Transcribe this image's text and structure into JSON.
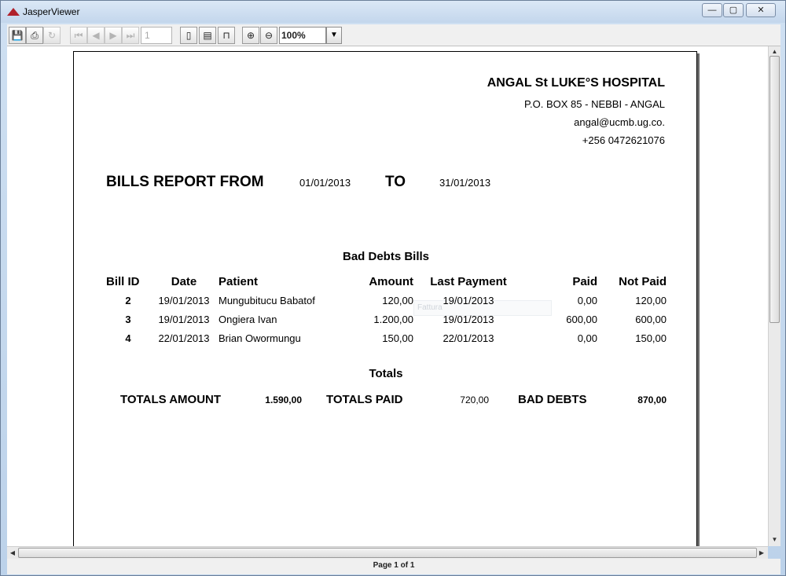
{
  "window": {
    "title": "JasperViewer",
    "min": "—",
    "max": "▢",
    "close": "✕"
  },
  "toolbar": {
    "save_icon": "💾",
    "print_icon": "⎙",
    "reload_icon": "↻",
    "first_icon": "⏮",
    "prev_icon": "◀",
    "next_icon": "▶",
    "last_icon": "⏭",
    "page_value": "1",
    "actual_size_icon": "▯",
    "fit_page_icon": "▤",
    "fit_width_icon": "⊓",
    "zoom_in_icon": "⊕",
    "zoom_out_icon": "⊖",
    "zoom_value": "100%",
    "zoom_arrow": "▼"
  },
  "report": {
    "hospital": {
      "name": "ANGAL St LUKE°S HOSPITAL",
      "address": "P.O. BOX 85 - NEBBI - ANGAL",
      "email": "angal@ucmb.ug.co.",
      "phone": "+256 0472621076"
    },
    "title": {
      "from_label": "BILLS REPORT FROM",
      "from_date": "01/01/2013",
      "to_label": "TO",
      "to_date": "31/01/2013"
    },
    "section_title": "Bad Debts Bills",
    "columns": {
      "bill_id": "Bill ID",
      "date": "Date",
      "patient": "Patient",
      "amount": "Amount",
      "last_payment": "Last Payment",
      "paid": "Paid",
      "not_paid": "Not Paid"
    },
    "rows": [
      {
        "bill_id": "2",
        "date": "19/01/2013",
        "patient": "Mungubitucu Babatof",
        "amount": "120,00",
        "last_payment": "19/01/2013",
        "paid": "0,00",
        "not_paid": "120,00"
      },
      {
        "bill_id": "3",
        "date": "19/01/2013",
        "patient": "Ongiera Ivan",
        "amount": "1.200,00",
        "last_payment": "19/01/2013",
        "paid": "600,00",
        "not_paid": "600,00"
      },
      {
        "bill_id": "4",
        "date": "22/01/2013",
        "patient": "Brian Owormungu",
        "amount": "150,00",
        "last_payment": "22/01/2013",
        "paid": "0,00",
        "not_paid": "150,00"
      }
    ],
    "totals": {
      "title": "Totals",
      "amount_label": "TOTALS AMOUNT",
      "amount_value": "1.590,00",
      "paid_label": "TOTALS PAID",
      "paid_value": "720,00",
      "bad_debts_label": "BAD DEBTS",
      "bad_debts_value": "870,00"
    },
    "ghost_field": "Fattura"
  },
  "scroll": {
    "up": "▲",
    "down": "▼",
    "left": "◀",
    "right": "▶"
  },
  "status": {
    "page_info": "Page 1 of 1"
  }
}
